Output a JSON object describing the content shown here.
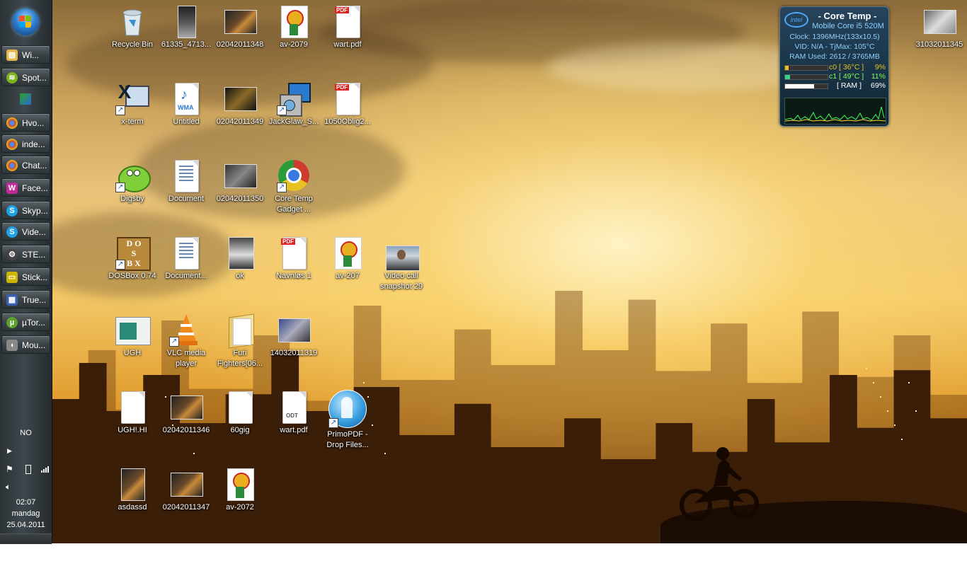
{
  "taskbar": {
    "buttons": [
      {
        "label": "Wi...",
        "icon": "folder-icon",
        "color": "#e7b64a"
      },
      {
        "label": "Spot...",
        "icon": "spotify-icon",
        "color": "#7ab51d"
      },
      {
        "label": "Hvo...",
        "icon": "chrome-icon",
        "color": "#d03b2f"
      },
      {
        "label": "inde...",
        "icon": "chrome-icon",
        "color": "#d03b2f"
      },
      {
        "label": "Chat...",
        "icon": "chrome-icon",
        "color": "#d03b2f"
      },
      {
        "label": "Face...",
        "icon": "digsby-icon",
        "color": "#c02a9a"
      },
      {
        "label": "Skyp...",
        "icon": "skype-icon",
        "color": "#1ea1e6"
      },
      {
        "label": "Vide...",
        "icon": "skype-icon",
        "color": "#1ea1e6"
      },
      {
        "label": "STE...",
        "icon": "steam-icon",
        "color": "#444"
      },
      {
        "label": "Stick...",
        "icon": "sticky-notes-icon",
        "color": "#ccb400"
      },
      {
        "label": "True...",
        "icon": "truecrypt-icon",
        "color": "#3a5fb0"
      },
      {
        "label": "µTor...",
        "icon": "utorrent-icon",
        "color": "#5aa02a"
      },
      {
        "label": "Mou...",
        "icon": "mouse-icon",
        "color": "#888"
      }
    ],
    "tray": {
      "language": "NO",
      "time": "02:07",
      "day": "mandag",
      "date": "25.04.2011"
    }
  },
  "desktop": {
    "icons": [
      {
        "label": "Recycle Bin",
        "type": "recycle-bin-icon"
      },
      {
        "label": "61335_4713...",
        "type": "photo-icon"
      },
      {
        "label": "02042011348",
        "type": "photo-icon"
      },
      {
        "label": "av-2079",
        "type": "avatar-icon"
      },
      {
        "label": "wart.pdf",
        "type": "pdf-icon"
      },
      {
        "label": "x-term",
        "type": "xterm-icon"
      },
      {
        "label": "Untitled",
        "type": "wma-icon"
      },
      {
        "label": "02042011349",
        "type": "photo-icon"
      },
      {
        "label": "JackGlaw_S...",
        "type": "installer-icon"
      },
      {
        "label": "1050Oblig2...",
        "type": "pdf-icon"
      },
      {
        "label": "Digsby",
        "type": "digsby-icon"
      },
      {
        "label": "Document",
        "type": "document-icon"
      },
      {
        "label": "02042011350",
        "type": "photo-icon"
      },
      {
        "label": "Core Temp Gadget ...",
        "type": "chrome-icon"
      },
      {
        "label": "DOSBox 0.74",
        "type": "dosbox-icon"
      },
      {
        "label": "Document...",
        "type": "document-icon"
      },
      {
        "label": "ok",
        "type": "photo-icon"
      },
      {
        "label": "Navnløs 1",
        "type": "pdf-icon"
      },
      {
        "label": "av-207",
        "type": "avatar-icon"
      },
      {
        "label": "Video call snapshot 29",
        "type": "photo-icon"
      },
      {
        "label": "UGH",
        "type": "ugh-icon"
      },
      {
        "label": "VLC media player",
        "type": "vlc-icon"
      },
      {
        "label": "Furi Fighters[06...",
        "type": "folder-icon"
      },
      {
        "label": "14032011319",
        "type": "photo-icon"
      },
      {
        "label": "UGH!.HI",
        "type": "blank-file-icon"
      },
      {
        "label": "02042011346",
        "type": "photo-icon"
      },
      {
        "label": "60gig",
        "type": "blank-file-icon"
      },
      {
        "label": "wart.pdf",
        "type": "odt-icon"
      },
      {
        "label": "PrimoPDF - Drop Files...",
        "type": "primopdf-icon"
      },
      {
        "label": "asdassd",
        "type": "photo-icon"
      },
      {
        "label": "02042011347",
        "type": "photo-icon"
      },
      {
        "label": "av-2072",
        "type": "avatar-icon"
      },
      {
        "label": "31032011345",
        "type": "photo-icon"
      }
    ]
  },
  "gadget": {
    "title": "- Core Temp -",
    "cpu": "Mobile Core i5 520M",
    "clock": "Clock: 1396MHz(133x10.5)",
    "vid": "VID: N/A - TjMax: 105°C",
    "ram_used": "RAM Used: 2612 / 3765MB",
    "core0_label": "c0 [ 36°C ]",
    "core0_load": "9%",
    "core0_fraction": 0.09,
    "core1_label": "c1 [ 49°C ]",
    "core1_load": "11%",
    "core1_fraction": 0.11,
    "ram_label": "[ RAM ]",
    "ram_load": "69%",
    "ram_fraction": 0.69,
    "logo": "intel"
  }
}
